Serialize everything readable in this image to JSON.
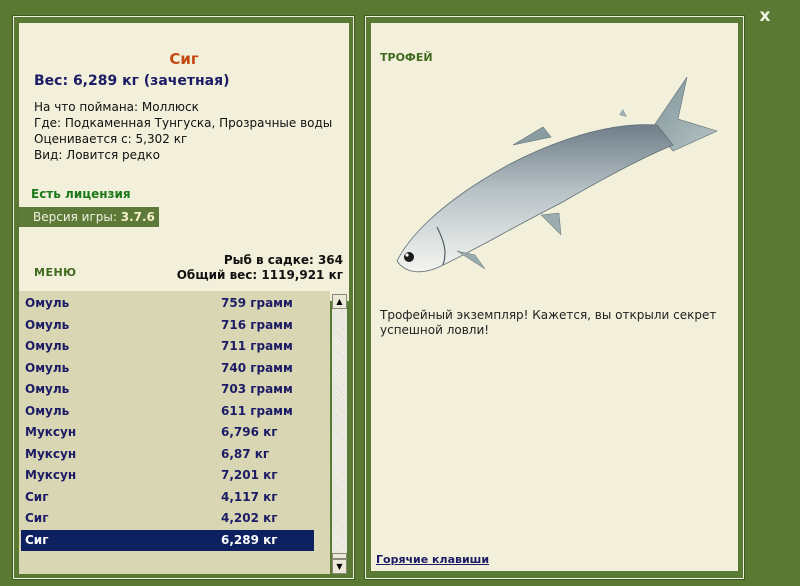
{
  "close_label": "x",
  "fish": {
    "name": "Сиг",
    "weight_line": "Вес: 6,289 кг (зачетная)",
    "bait": "На что поймана: Моллюск",
    "place": "Где: Подкаменная Тунгуска, Прозрачные воды",
    "value": "Оценивается с: 5,302 кг",
    "kind": "Вид: Ловится редко"
  },
  "license": "Есть лицензия",
  "version": {
    "label": "Версия игры:",
    "value": "3.7.6"
  },
  "menu_label": "МЕНЮ",
  "stats": {
    "fish_in_cage": "Рыб в садке: 364",
    "total_weight": "Общий вес: 1119,921 кг"
  },
  "catch_list": [
    {
      "name": "Омуль",
      "weight": "759 грамм"
    },
    {
      "name": "Омуль",
      "weight": "716 грамм"
    },
    {
      "name": "Омуль",
      "weight": "711 грамм"
    },
    {
      "name": "Омуль",
      "weight": "740 грамм"
    },
    {
      "name": "Омуль",
      "weight": "703 грамм"
    },
    {
      "name": "Омуль",
      "weight": "611 грамм"
    },
    {
      "name": "Муксун",
      "weight": "6,796 кг"
    },
    {
      "name": "Муксун",
      "weight": "6,87 кг"
    },
    {
      "name": "Муксун",
      "weight": "7,201 кг"
    },
    {
      "name": "Сиг",
      "weight": "4,117 кг"
    },
    {
      "name": "Сиг",
      "weight": "4,202 кг"
    },
    {
      "name": "Сиг",
      "weight": "6,289 кг",
      "selected": true
    }
  ],
  "scroll": {
    "up_arrow": "▲",
    "down_arrow": "▼"
  },
  "trophy": {
    "label": "ТРОФЕЙ",
    "text": "Трофейный экземпляр! Кажется, вы открыли секрет успешной ловли!"
  },
  "hotkeys_label": "Горячие клавиши",
  "colors": {
    "background": "#5a7a34",
    "panel": "#f2efda",
    "list_bg": "#d9d6b4",
    "selected_row": "#0d2060",
    "fish_name": "#c44a12",
    "text_blue": "#1c1c66",
    "license_green": "#1a7a1a"
  }
}
